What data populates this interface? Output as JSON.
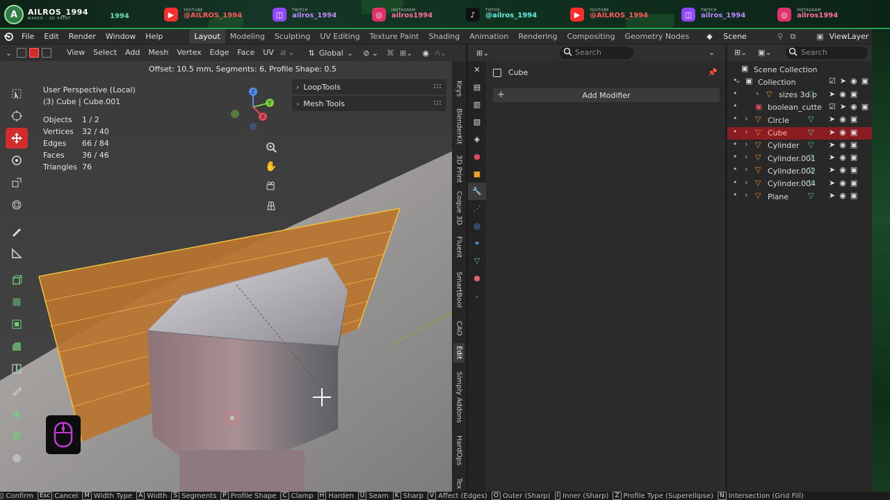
{
  "banner": {
    "brand_name": "AILROS_1994",
    "brand_sub": "MAKER - 3D PRINT",
    "brand_letter": "A",
    "brand_tag": "1994",
    "socials": [
      {
        "icon": "youtube-icon",
        "label": "YOUTUBE",
        "handle": "@AILROS_1994",
        "color": "#ff2e2e",
        "handle_color": "#ff5a5a"
      },
      {
        "icon": "twitch-icon",
        "label": "TWITCH",
        "handle": "ailros_1994",
        "color": "#9146ff",
        "handle_color": "#b98bff"
      },
      {
        "icon": "instagram-icon",
        "label": "INSTAGRAM",
        "handle": "ailros1994",
        "color": "#e1306c",
        "handle_color": "#ff6fa0"
      },
      {
        "icon": "tiktok-icon",
        "label": "TIKTOK",
        "handle": "@ailros_1994",
        "color": "#111111",
        "handle_color": "#5ff0e0"
      },
      {
        "icon": "youtube-icon",
        "label": "YOUTUBE",
        "handle": "@AILROS_1994",
        "color": "#ff2e2e",
        "handle_color": "#ff5a5a"
      },
      {
        "icon": "twitch-icon",
        "label": "TWITCH",
        "handle": "ailros_1994",
        "color": "#9146ff",
        "handle_color": "#b98bff"
      },
      {
        "icon": "instagram-icon",
        "label": "INSTAGRAM",
        "handle": "ailros1994",
        "color": "#e1306c",
        "handle_color": "#ff6fa0"
      }
    ]
  },
  "menubar": {
    "menus": [
      "File",
      "Edit",
      "Render",
      "Window",
      "Help"
    ],
    "workspaces": [
      "Layout",
      "Modeling",
      "Sculpting",
      "UV Editing",
      "Texture Paint",
      "Shading",
      "Animation",
      "Rendering",
      "Compositing",
      "Geometry Nodes"
    ],
    "active_workspace": "Layout",
    "scene": "Scene",
    "view_layer": "ViewLayer"
  },
  "viewport": {
    "header_menus": [
      "View",
      "Select",
      "Add",
      "Mesh",
      "Vertex",
      "Edge",
      "Face",
      "UV"
    ],
    "orientation": "Global",
    "operator_info": "Offset: 10.5 mm, Segments: 6, Profile Shape: 0.5",
    "view_name": "User Perspective (Local)",
    "object_name": "(3) Cube | Cube.001",
    "stats": [
      {
        "label": "Objects",
        "value": "1 / 2"
      },
      {
        "label": "Vertices",
        "value": "32 / 40"
      },
      {
        "label": "Edges",
        "value": "66 / 84"
      },
      {
        "label": "Faces",
        "value": "36 / 46"
      },
      {
        "label": "Triangles",
        "value": "76"
      }
    ],
    "panels": [
      "LoopTools",
      "Mesh Tools"
    ],
    "gizmo_axes": {
      "z": "Z",
      "y": "Y",
      "x": "X"
    },
    "n_tabs": [
      "Keys",
      "BlenderKit",
      "3D Print",
      "Coque 3D",
      "Fluent",
      "SmartBool",
      "CAO",
      "Edit",
      "Simply Addons",
      "HardOps",
      "Tex"
    ],
    "active_n_tab": "Edit",
    "colors": {
      "selection": "#f0a020",
      "tool_active": "#d22d2d"
    }
  },
  "properties": {
    "search_placeholder": "Search",
    "object_name": "Cube",
    "add_modifier_label": "Add Modifier"
  },
  "outliner": {
    "search_placeholder": "Search",
    "items": [
      {
        "name": "Scene Collection",
        "depth": 0,
        "kind": "scene"
      },
      {
        "name": "Collection",
        "depth": 1,
        "kind": "collection"
      },
      {
        "name": "sizes 3d p",
        "depth": 2,
        "kind": "object"
      },
      {
        "name": "boolean_cutte",
        "depth": 1,
        "kind": "collection-red"
      },
      {
        "name": "Circle",
        "depth": 1,
        "kind": "object"
      },
      {
        "name": "Cube",
        "depth": 1,
        "kind": "object",
        "selected": true
      },
      {
        "name": "Cylinder",
        "depth": 1,
        "kind": "object"
      },
      {
        "name": "Cylinder.001",
        "depth": 1,
        "kind": "object"
      },
      {
        "name": "Cylinder.002",
        "depth": 1,
        "kind": "object"
      },
      {
        "name": "Cylinder.004",
        "depth": 1,
        "kind": "object"
      },
      {
        "name": "Plane",
        "depth": 1,
        "kind": "object"
      }
    ]
  },
  "statusbar": [
    {
      "key": "",
      "label": "Confirm"
    },
    {
      "key": "Esc",
      "label": "Cancel"
    },
    {
      "key": "M",
      "label": "Width Type"
    },
    {
      "key": "A",
      "label": "Width"
    },
    {
      "key": "S",
      "label": "Segments"
    },
    {
      "key": "P",
      "label": "Profile Shape"
    },
    {
      "key": "C",
      "label": "Clamp"
    },
    {
      "key": "H",
      "label": "Harden"
    },
    {
      "key": "U",
      "label": "Seam"
    },
    {
      "key": "K",
      "label": "Sharp"
    },
    {
      "key": "V",
      "label": "Affect (Edges)"
    },
    {
      "key": "O",
      "label": "Outer (Sharp)"
    },
    {
      "key": "I",
      "label": "Inner (Sharp)"
    },
    {
      "key": "Z",
      "label": "Profile Type (Superellipse)"
    },
    {
      "key": "N",
      "label": "Intersection (Grid Fill)"
    }
  ]
}
